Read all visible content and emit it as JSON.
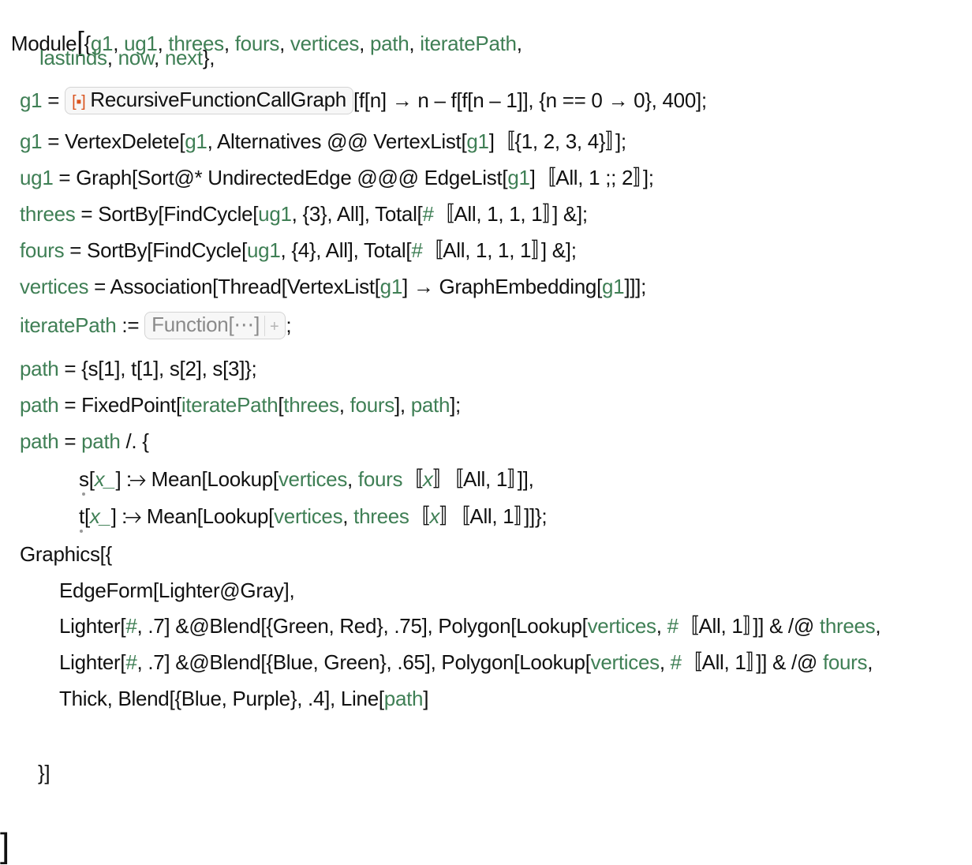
{
  "cell": {
    "head": "Module",
    "locals_line1": [
      "g1",
      "ug1",
      "threes",
      "fours",
      "vertices",
      "path",
      "iteratePath"
    ],
    "locals_line2": [
      "lastinds",
      "now",
      "next"
    ],
    "g1_def": {
      "var": "g1",
      "resource_fn_label": "RecursiveFunctionCallGraph",
      "args": "[f[n] → n – f[f[n – 1]], {n == 0 → 0}, 400];"
    },
    "g1_delete": {
      "var": "g1",
      "rhs_a": "VertexDelete[",
      "v1": "g1",
      "rhs_b": ", Alternatives @@ VertexList[",
      "v2": "g1",
      "rhs_c": "]〚{1, 2, 3, 4}〛];"
    },
    "ug1_def": {
      "var": "ug1",
      "rhs_a": "Graph[Sort@* UndirectedEdge @@@ EdgeList[",
      "v1": "g1",
      "rhs_b": "]〚All, 1 ;; 2〛];"
    },
    "threes_def": {
      "var": "threes",
      "rhs_a": "SortBy[FindCycle[",
      "v1": "ug1",
      "rhs_b": ", {3}, All], Total[",
      "slot": "#",
      "rhs_c": "〚All, 1, 1, 1〛] &];"
    },
    "fours_def": {
      "var": "fours",
      "rhs_a": "SortBy[FindCycle[",
      "v1": "ug1",
      "rhs_b": ", {4}, All], Total[",
      "slot": "#",
      "rhs_c": "〚All, 1, 1, 1〛] &];"
    },
    "vertices_def": {
      "var": "vertices",
      "rhs_a": "Association[Thread[VertexList[",
      "v1": "g1",
      "rhs_b": "] → GraphEmbedding[",
      "v2": "g1",
      "rhs_c": "]]];"
    },
    "iterate_def": {
      "var": "iteratePath",
      "op": ":=",
      "fn_label": "Function[⋯]",
      "plus": "+",
      "end": ";"
    },
    "path_init": {
      "var": "path",
      "rhs": "{s[1], t[1], s[2], s[3]};"
    },
    "path_fixed": {
      "var": "path",
      "rhs_a": "FixedPoint[",
      "v1": "iteratePath",
      "rhs_b": "[",
      "v2": "threes",
      "rhs_c": ", ",
      "v3": "fours",
      "rhs_d": "], ",
      "v4": "path",
      "rhs_e": "];"
    },
    "path_replace": {
      "var": "path",
      "v1": "path",
      "rhs": " /. {"
    },
    "rule_s": {
      "sym": "s",
      "pat": "x_",
      "rhs_a": "] ⧴ Mean[Lookup[",
      "v1": "vertices",
      "rhs_b": ", ",
      "v2": "fours",
      "rhs_c": "〚",
      "v3": "x",
      "rhs_d": "〛〚All, 1〛]],"
    },
    "rule_t": {
      "sym": "t",
      "pat": "x_",
      "rhs_a": "] ⧴ Mean[Lookup[",
      "v1": "vertices",
      "rhs_b": ", ",
      "v2": "threes",
      "rhs_c": "〚",
      "v3": "x",
      "rhs_d": "〛〚All, 1〛]]};"
    },
    "graphics_head": "Graphics[{",
    "gfx_edgeform": "EdgeForm[Lighter@Gray],",
    "gfx_threes": {
      "a": "Lighter[",
      "slot": "#",
      "b": ", .7] &@Blend[{Green, Red}, .75], Polygon[Lookup[",
      "v1": "vertices",
      "c": ", ",
      "slot2": "#",
      "d": "〚All, 1〛]] & /@ ",
      "v2": "threes",
      "e": ","
    },
    "gfx_fours": {
      "a": "Lighter[",
      "slot": "#",
      "b": ", .7] &@Blend[{Blue, Green}, .65], Polygon[Lookup[",
      "v1": "vertices",
      "c": ", ",
      "slot2": "#",
      "d": "〚All, 1〛]] & /@ ",
      "v2": "fours",
      "e": ","
    },
    "gfx_line": {
      "a": "Thick, Blend[{Blue, Purple}, .4], Line[",
      "v1": "path",
      "b": "]"
    },
    "graphics_close": "}]",
    "module_close": "]"
  },
  "colors": {
    "local_var": "#3f7f55",
    "resource_icon": "#d9531e",
    "text": "#111111"
  }
}
